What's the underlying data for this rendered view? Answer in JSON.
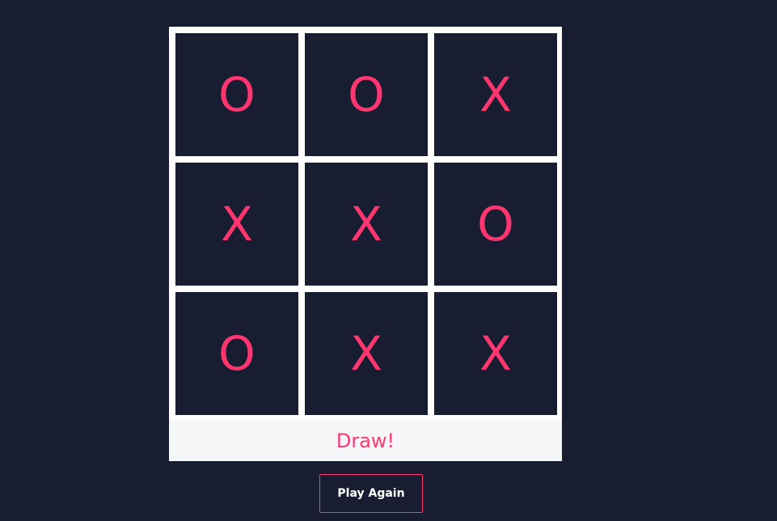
{
  "board": {
    "cells": [
      "O",
      "O",
      "X",
      "X",
      "X",
      "O",
      "O",
      "X",
      "X"
    ]
  },
  "status": {
    "text": "Draw!"
  },
  "controls": {
    "play_again_label": "Play Again"
  },
  "colors": {
    "background": "#191d31",
    "mark": "#ff3670",
    "grid_lines": "#ffffff",
    "status_bar": "#f5f6f8",
    "button_text": "#ffffff",
    "button_border": "#ff3670"
  }
}
